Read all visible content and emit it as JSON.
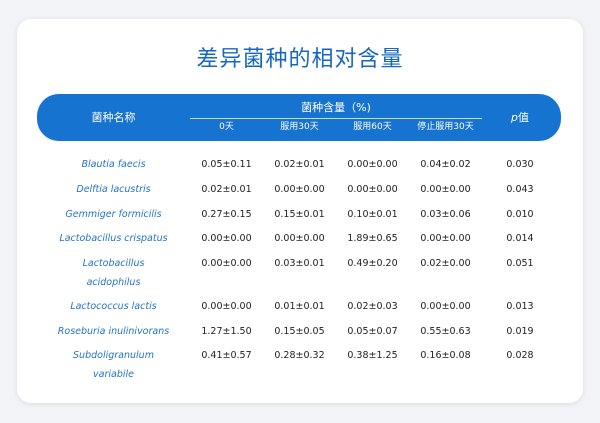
{
  "title": "差异菌种的相对含量",
  "header": {
    "name_col": "菌种名称",
    "group_label": "菌种含量（%)",
    "sub_cols": [
      "0天",
      "服用30天",
      "服用60天",
      "停止服用30天"
    ],
    "p_prefix": "p",
    "p_suffix": "值"
  },
  "rows": [
    {
      "name": "Blautia faecis",
      "values": [
        "0.05±0.11",
        "0.02±0.01",
        "0.00±0.00",
        "0.04±0.02"
      ],
      "p": "0.030"
    },
    {
      "name": "Delftia lacustris",
      "values": [
        "0.02±0.01",
        "0.00±0.00",
        "0.00±0.00",
        "0.00±0.00"
      ],
      "p": "0.043"
    },
    {
      "name": "Gemmiger formicilis",
      "values": [
        "0.27±0.15",
        "0.15±0.01",
        "0.10±0.01",
        "0.03±0.06"
      ],
      "p": "0.010"
    },
    {
      "name": "Lactobacillus crispatus",
      "values": [
        "0.00±0.00",
        "0.00±0.00",
        "1.89±0.65",
        "0.00±0.00"
      ],
      "p": "0.014"
    },
    {
      "name": "Lactobacillus acidophilus",
      "values": [
        "0.00±0.00",
        "0.03±0.01",
        "0.49±0.20",
        "0.02±0.00"
      ],
      "p": "0.051"
    },
    {
      "name": "Lactococcus lactis",
      "values": [
        "0.00±0.00",
        "0.01±0.01",
        "0.02±0.03",
        "0.00±0.00"
      ],
      "p": "0.013"
    },
    {
      "name": "Roseburia inulinivorans",
      "values": [
        "1.27±1.50",
        "0.15±0.05",
        "0.05±0.07",
        "0.55±0.63"
      ],
      "p": "0.019"
    },
    {
      "name": "Subdoligranulum variabile",
      "values": [
        "0.41±0.57",
        "0.28±0.32",
        "0.38±1.25",
        "0.16±0.08"
      ],
      "p": "0.028"
    }
  ],
  "colors": {
    "accent": "#1673cf",
    "title": "#1667c1",
    "species_name": "#2474c6",
    "page_bg": "#f3f4f7",
    "card_bg": "#ffffff"
  }
}
